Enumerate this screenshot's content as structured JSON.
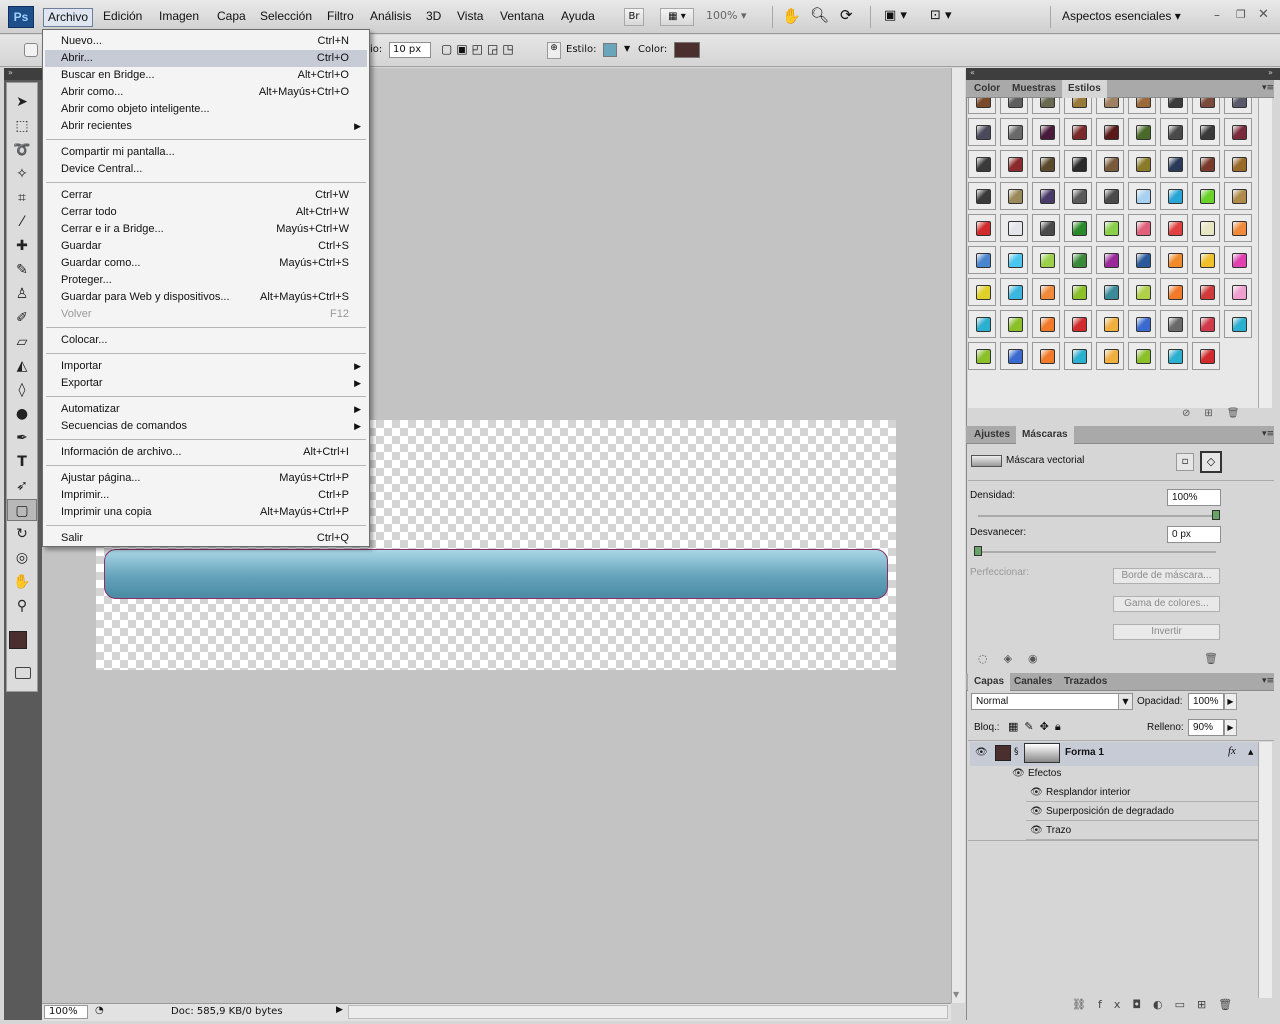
{
  "menubar": {
    "logo": "Ps",
    "items": [
      "Archivo",
      "Edición",
      "Imagen",
      "Capa",
      "Selección",
      "Filtro",
      "Análisis",
      "3D",
      "Vista",
      "Ventana",
      "Ayuda"
    ],
    "bridge": "Br",
    "zoom": "100%",
    "workspace": "Aspectos esenciales"
  },
  "options": {
    "radius_label": "io:",
    "radius_value": "10 px",
    "style_label": "Estilo:",
    "color_label": "Color:",
    "style_color": "#6aa6bb",
    "fill_color": "#4b2e2e"
  },
  "file_menu": {
    "groups": [
      [
        {
          "label": "Nuevo...",
          "shortcut": "Ctrl+N"
        },
        {
          "label": "Abrir...",
          "shortcut": "Ctrl+O",
          "highlight": true
        },
        {
          "label": "Buscar en Bridge...",
          "shortcut": "Alt+Ctrl+O"
        },
        {
          "label": "Abrir como...",
          "shortcut": "Alt+Mayús+Ctrl+O"
        },
        {
          "label": "Abrir como objeto inteligente...",
          "shortcut": ""
        },
        {
          "label": "Abrir recientes",
          "shortcut": "",
          "submenu": true
        }
      ],
      [
        {
          "label": "Compartir mi pantalla...",
          "shortcut": ""
        },
        {
          "label": "Device Central...",
          "shortcut": ""
        }
      ],
      [
        {
          "label": "Cerrar",
          "shortcut": "Ctrl+W"
        },
        {
          "label": "Cerrar todo",
          "shortcut": "Alt+Ctrl+W"
        },
        {
          "label": "Cerrar e ir a Bridge...",
          "shortcut": "Mayús+Ctrl+W"
        },
        {
          "label": "Guardar",
          "shortcut": "Ctrl+S"
        },
        {
          "label": "Guardar como...",
          "shortcut": "Mayús+Ctrl+S"
        },
        {
          "label": "Proteger...",
          "shortcut": ""
        },
        {
          "label": "Guardar para Web y dispositivos...",
          "shortcut": "Alt+Mayús+Ctrl+S"
        },
        {
          "label": "Volver",
          "shortcut": "F12",
          "disabled": true
        }
      ],
      [
        {
          "label": "Colocar...",
          "shortcut": ""
        }
      ],
      [
        {
          "label": "Importar",
          "shortcut": "",
          "submenu": true
        },
        {
          "label": "Exportar",
          "shortcut": "",
          "submenu": true
        }
      ],
      [
        {
          "label": "Automatizar",
          "shortcut": "",
          "submenu": true
        },
        {
          "label": "Secuencias de comandos",
          "shortcut": "",
          "submenu": true
        }
      ],
      [
        {
          "label": "Información de archivo...",
          "shortcut": "Alt+Ctrl+I"
        }
      ],
      [
        {
          "label": "Ajustar página...",
          "shortcut": "Mayús+Ctrl+P"
        },
        {
          "label": "Imprimir...",
          "shortcut": "Ctrl+P"
        },
        {
          "label": "Imprimir una copia",
          "shortcut": "Alt+Mayús+Ctrl+P"
        }
      ],
      [
        {
          "label": "Salir",
          "shortcut": "Ctrl+Q"
        }
      ]
    ]
  },
  "styles_panel": {
    "tabs": [
      "Color",
      "Muestras",
      "Estilos"
    ],
    "swatch_colors": [
      "#7a4a2a",
      "#5e5e5e",
      "#6a6a52",
      "#9a7a3a",
      "#a08060",
      "#9a6a3a",
      "#3a3a3a",
      "#7a4a3a",
      "#5a5a6a",
      "#4a4a5a",
      "#6a6a6a",
      "#4a1a3a",
      "#7a2a2a",
      "#5a1a1a",
      "#4a6a2a",
      "#4a4a4a",
      "#3a3a3a",
      "#7a2a3a",
      "#3a3a3a",
      "#8a2a2a",
      "#5a4a2a",
      "#2a2a2a",
      "#7a5a3a",
      "#8a7a2a",
      "#2a3a5a",
      "#7a3a2a",
      "#9a6a2a",
      "#3a3a3a",
      "#9a8a5a",
      "#4a3a6a",
      "#5a5a5a",
      "#4a4a4a",
      "#a8d0f0",
      "#2aa6d6",
      "#6ad02a",
      "#b08a4a",
      "#d02a2a",
      "#e4e4ec",
      "#4a4a4a",
      "#2a8a2a",
      "#8ad04a",
      "#e0607a",
      "#e04040",
      "#e6e6c0",
      "#f08a3a",
      "#4a86d0",
      "#4ac6f0",
      "#9ad04a",
      "#3a8a3a",
      "#9a2a9a",
      "#2a5a9a",
      "#f08a2a",
      "#f0c02a",
      "#e040b0",
      "#e0d02a",
      "#3ab6e0",
      "#f08a3a",
      "#8ac02a",
      "#3a8a9a",
      "#b0d04a",
      "#f07a2a",
      "#d03a3a",
      "#f0a0d0",
      "#2ab0d0",
      "#8ac02a",
      "#f07a2a",
      "#d02a2a",
      "#f0b040",
      "#3a6ad0",
      "#6a6a6a",
      "#d03a4a",
      "#2ab0d0",
      "#8ac02a",
      "#3a6ad0",
      "#f07a2a",
      "#2ab0d0",
      "#f0b040",
      "#8ac02a",
      "#2ab0d0",
      "#d02a2a"
    ]
  },
  "masks_panel": {
    "tabs": [
      "Ajustes",
      "Máscaras"
    ],
    "title": "Máscara vectorial",
    "density_label": "Densidad:",
    "density_value": "100%",
    "feather_label": "Desvanecer:",
    "feather_value": "0 px",
    "refine_label": "Perfeccionar:",
    "btn_mask_edge": "Borde de máscara...",
    "btn_color_range": "Gama de colores...",
    "btn_invert": "Invertir",
    "density_fraction": 1.0,
    "feather_fraction": 0.0
  },
  "layers_panel": {
    "tabs": [
      "Capas",
      "Canales",
      "Trazados"
    ],
    "blend_mode": "Normal",
    "opacity_label": "Opacidad:",
    "opacity_value": "100%",
    "lock_label": "Bloq.:",
    "fill_label": "Relleno:",
    "fill_value": "90%",
    "layer_name": "Forma 1",
    "fx": "fx",
    "effects_label": "Efectos",
    "effects": [
      "Resplandor interior",
      "Superposición de degradado",
      "Trazo"
    ]
  },
  "status": {
    "zoom": "100%",
    "doc": "Doc: 585,9 KB/0 bytes"
  }
}
